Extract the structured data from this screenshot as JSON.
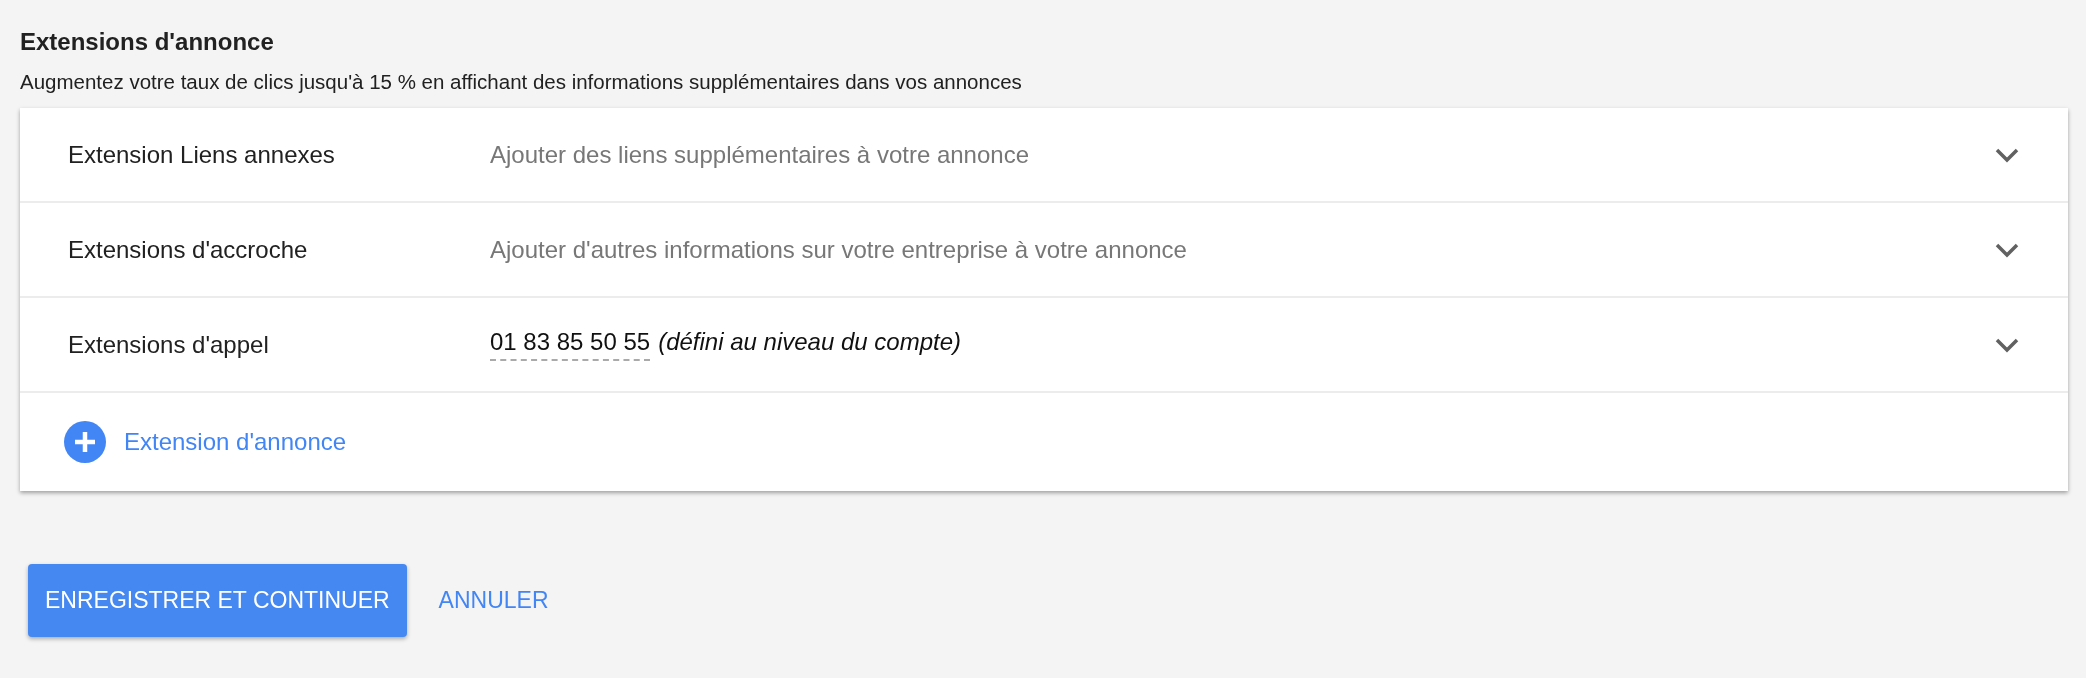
{
  "section": {
    "title": "Extensions d'annonce",
    "subtitle": "Augmentez votre taux de clics jusqu'à 15 % en affichant des informations supplémentaires dans vos annonces"
  },
  "extensions": [
    {
      "kind": "description",
      "label": "Extension Liens annexes",
      "description": "Ajouter des liens supplémentaires à votre annonce",
      "expanded": false
    },
    {
      "kind": "description",
      "label": "Extensions d'accroche",
      "description": "Ajouter d'autres informations sur votre entreprise à votre annonce",
      "expanded": false
    },
    {
      "kind": "phone",
      "label": "Extensions d'appel",
      "value": "01 83 85 50 55",
      "note": "(défini au niveau du compte)",
      "expanded": false
    }
  ],
  "add_link": "Extension d'annonce",
  "buttons": [
    {
      "kind": "primary",
      "label": "ENREGISTRER ET CONTINUER"
    },
    {
      "kind": "flat",
      "label": "ANNULER"
    }
  ]
}
